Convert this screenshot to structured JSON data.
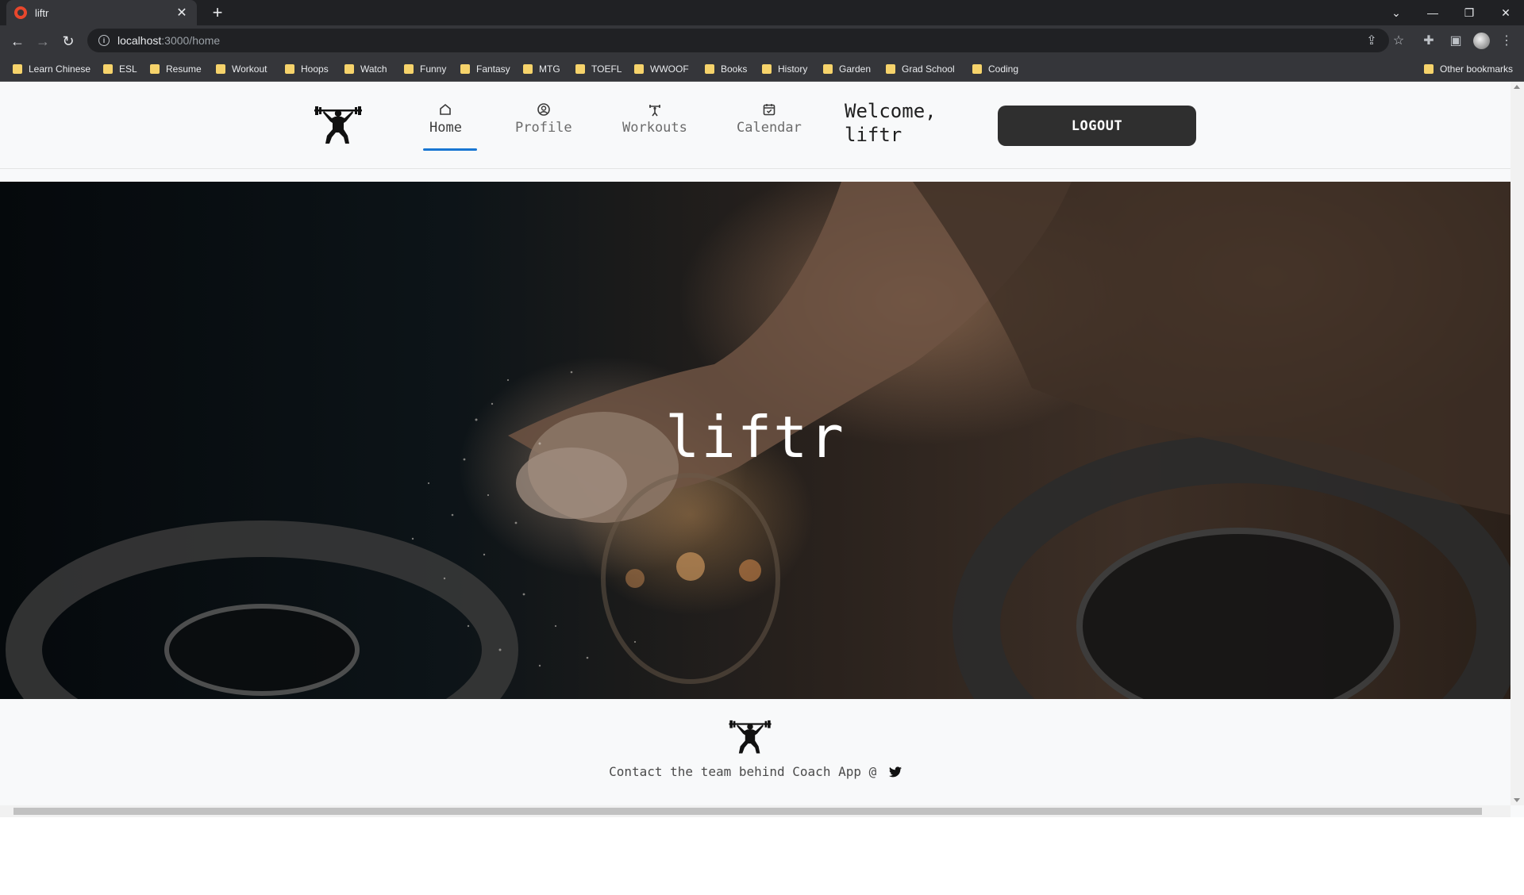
{
  "browser": {
    "tab_title": "liftr",
    "url_host": "localhost",
    "url_path": ":3000/home",
    "bookmarks": [
      "Learn Chinese",
      "ESL",
      "Resume",
      "Workout",
      "Hoops",
      "Watch",
      "Funny",
      "Fantasy",
      "MTG",
      "TOEFL",
      "WWOOF",
      "Books",
      "History",
      "Garden",
      "Grad School",
      "Coding"
    ],
    "other_bookmarks": "Other bookmarks"
  },
  "nav": {
    "items": [
      {
        "label": "Home",
        "icon": "home-icon",
        "active": true
      },
      {
        "label": "Profile",
        "icon": "profile-icon",
        "active": false
      },
      {
        "label": "Workouts",
        "icon": "dumbbell-icon",
        "active": false
      },
      {
        "label": "Calendar",
        "icon": "calendar-icon",
        "active": false
      }
    ],
    "welcome_line1": "Welcome,",
    "welcome_line2": "liftr",
    "logout_label": "LOGOUT"
  },
  "hero": {
    "title": "liftr"
  },
  "footer": {
    "text": "Contact the team behind Coach App @",
    "icon": "twitter-icon"
  },
  "colors": {
    "accent": "#1976d2",
    "button": "#2f2f2f",
    "page_bg": "#f8f9fa"
  }
}
